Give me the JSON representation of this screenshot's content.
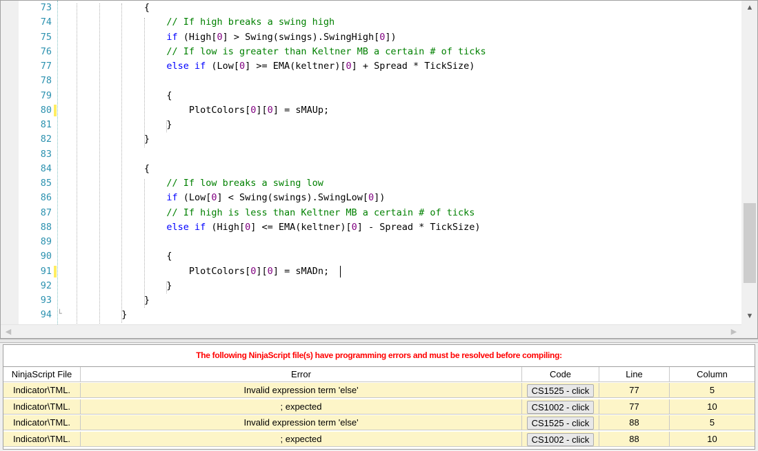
{
  "editor": {
    "lines": [
      {
        "num": "73",
        "indent": 14,
        "modified": false,
        "tokens": [
          {
            "t": "{"
          }
        ]
      },
      {
        "num": "74",
        "indent": 18,
        "modified": false,
        "tokens": [
          {
            "t": "// If high breaks a swing high",
            "c": "cm"
          }
        ]
      },
      {
        "num": "75",
        "indent": 18,
        "modified": false,
        "tokens": [
          {
            "t": "if",
            "c": "kw"
          },
          {
            "t": " (High["
          },
          {
            "t": "0",
            "c": "num"
          },
          {
            "t": "] > Swing(swings).SwingHigh["
          },
          {
            "t": "0",
            "c": "num"
          },
          {
            "t": "])"
          }
        ]
      },
      {
        "num": "76",
        "indent": 18,
        "modified": false,
        "tokens": [
          {
            "t": "// If low is greater than Keltner MB a certain # of ticks",
            "c": "cm"
          }
        ]
      },
      {
        "num": "77",
        "indent": 18,
        "modified": false,
        "tokens": [
          {
            "t": "else if",
            "c": "kw"
          },
          {
            "t": " (Low["
          },
          {
            "t": "0",
            "c": "num"
          },
          {
            "t": "] >= EMA(keltner)["
          },
          {
            "t": "0",
            "c": "num"
          },
          {
            "t": "] + Spread * TickSize)"
          }
        ]
      },
      {
        "num": "78",
        "indent": 0,
        "modified": false,
        "tokens": []
      },
      {
        "num": "79",
        "indent": 18,
        "modified": false,
        "tokens": [
          {
            "t": "{"
          }
        ]
      },
      {
        "num": "80",
        "indent": 22,
        "modified": true,
        "tokens": [
          {
            "t": "PlotColors["
          },
          {
            "t": "0",
            "c": "num"
          },
          {
            "t": "]["
          },
          {
            "t": "0",
            "c": "num"
          },
          {
            "t": "] = sMAUp;"
          }
        ]
      },
      {
        "num": "81",
        "indent": 18,
        "modified": false,
        "tokens": [
          {
            "t": "}"
          }
        ]
      },
      {
        "num": "82",
        "indent": 14,
        "modified": false,
        "tokens": [
          {
            "t": "}"
          }
        ]
      },
      {
        "num": "83",
        "indent": 0,
        "modified": false,
        "tokens": []
      },
      {
        "num": "84",
        "indent": 14,
        "modified": false,
        "tokens": [
          {
            "t": "{"
          }
        ]
      },
      {
        "num": "85",
        "indent": 18,
        "modified": false,
        "tokens": [
          {
            "t": "// If low breaks a swing low",
            "c": "cm"
          }
        ]
      },
      {
        "num": "86",
        "indent": 18,
        "modified": false,
        "tokens": [
          {
            "t": "if",
            "c": "kw"
          },
          {
            "t": " (Low["
          },
          {
            "t": "0",
            "c": "num"
          },
          {
            "t": "] < Swing(swings).SwingLow["
          },
          {
            "t": "0",
            "c": "num"
          },
          {
            "t": "])"
          }
        ]
      },
      {
        "num": "87",
        "indent": 18,
        "modified": false,
        "tokens": [
          {
            "t": "// If high is less than Keltner MB a certain # of ticks",
            "c": "cm"
          }
        ]
      },
      {
        "num": "88",
        "indent": 18,
        "modified": false,
        "tokens": [
          {
            "t": "else if",
            "c": "kw"
          },
          {
            "t": " (High["
          },
          {
            "t": "0",
            "c": "num"
          },
          {
            "t": "] <= EMA(keltner)["
          },
          {
            "t": "0",
            "c": "num"
          },
          {
            "t": "] - Spread * TickSize)"
          }
        ]
      },
      {
        "num": "89",
        "indent": 0,
        "modified": false,
        "tokens": []
      },
      {
        "num": "90",
        "indent": 18,
        "modified": false,
        "tokens": [
          {
            "t": "{"
          }
        ]
      },
      {
        "num": "91",
        "indent": 22,
        "modified": true,
        "caret": true,
        "tokens": [
          {
            "t": "PlotColors["
          },
          {
            "t": "0",
            "c": "num"
          },
          {
            "t": "]["
          },
          {
            "t": "0",
            "c": "num"
          },
          {
            "t": "] = sMADn;"
          }
        ]
      },
      {
        "num": "92",
        "indent": 18,
        "modified": false,
        "tokens": [
          {
            "t": "}"
          }
        ]
      },
      {
        "num": "93",
        "indent": 14,
        "modified": false,
        "tokens": [
          {
            "t": "}"
          }
        ]
      },
      {
        "num": "94",
        "indent": 10,
        "modified": false,
        "tokens": [
          {
            "t": "}"
          }
        ]
      }
    ]
  },
  "errors": {
    "banner": "The following NinjaScript file(s) have programming errors and must be resolved before compiling:",
    "columns": [
      "NinjaScript File",
      "Error",
      "Code",
      "Line",
      "Column"
    ],
    "rows": [
      {
        "file": "Indicator\\TML.",
        "error": "Invalid expression term 'else'",
        "code": "CS1525 - click",
        "line": "77",
        "column": "5"
      },
      {
        "file": "Indicator\\TML.",
        "error": "; expected",
        "code": "CS1002 - click",
        "line": "77",
        "column": "10"
      },
      {
        "file": "Indicator\\TML.",
        "error": "Invalid expression term 'else'",
        "code": "CS1525 - click",
        "line": "88",
        "column": "5"
      },
      {
        "file": "Indicator\\TML.",
        "error": "; expected",
        "code": "CS1002 - click",
        "line": "88",
        "column": "10"
      }
    ]
  },
  "icons": {
    "scroll_up": "▲",
    "scroll_down": "▼",
    "scroll_left": "◀",
    "scroll_right": "▶"
  }
}
